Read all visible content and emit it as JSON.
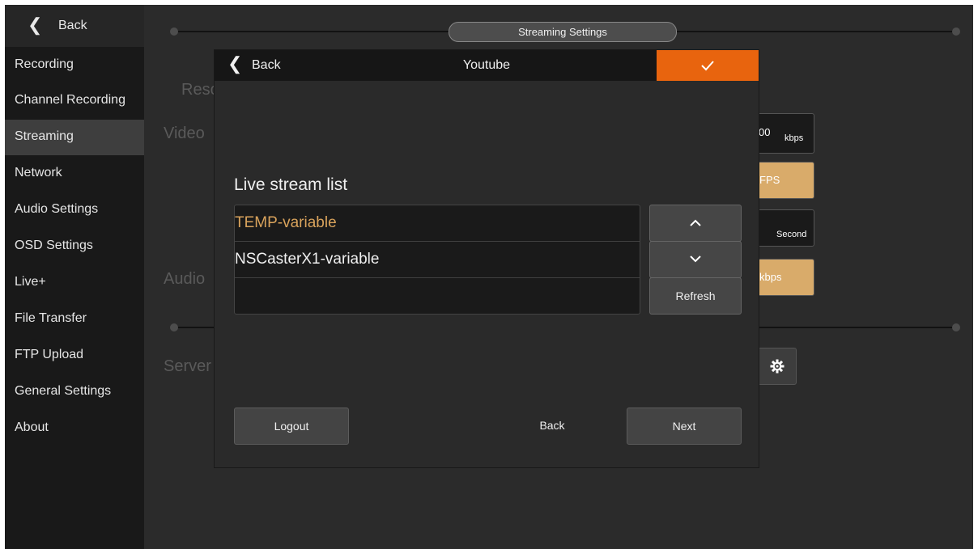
{
  "sidebar": {
    "back_label": "Back",
    "items": [
      {
        "label": "Recording"
      },
      {
        "label": "Channel Recording"
      },
      {
        "label": "Streaming",
        "active": true
      },
      {
        "label": "Network"
      },
      {
        "label": "Audio Settings"
      },
      {
        "label": "OSD Settings"
      },
      {
        "label": "Live+"
      },
      {
        "label": "File Transfer"
      },
      {
        "label": "FTP Upload"
      },
      {
        "label": "General Settings"
      },
      {
        "label": "About"
      }
    ]
  },
  "background": {
    "section_title": "Streaming Settings",
    "labels": {
      "resolution": "Resc",
      "video": "Video",
      "audio": "Audio",
      "server": "Server"
    },
    "bitrate_value": "00",
    "bitrate_unit": "kbps",
    "fps_text": "FPS",
    "interval_unit": "Second",
    "audio_bitrate_text": "kbps"
  },
  "dialog": {
    "back_label": "Back",
    "title": "Youtube",
    "list_label": "Live stream list",
    "streams": [
      {
        "name": "TEMP-variable",
        "selected": true
      },
      {
        "name": "NSCasterX1-variable",
        "selected": false
      },
      {
        "name": "",
        "selected": false
      }
    ],
    "refresh_label": "Refresh",
    "logout_label": "Logout",
    "footer_back_label": "Back",
    "next_label": "Next"
  },
  "colors": {
    "accent_orange": "#e8640e",
    "selected_text": "#d9a35c",
    "gold_field": "#d9ab6a"
  },
  "icons": {
    "back": "chevron-left-icon",
    "confirm": "check-icon",
    "up": "chevron-up-icon",
    "down": "chevron-down-icon",
    "settings": "gear-icon"
  }
}
